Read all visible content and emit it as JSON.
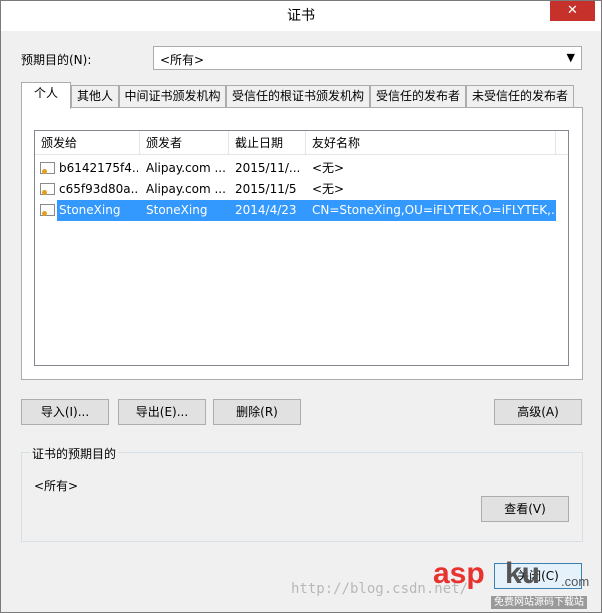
{
  "window": {
    "title": "证书",
    "close": "✕"
  },
  "purpose": {
    "label": "预期目的(N):",
    "value": "<所有>"
  },
  "tabs": [
    {
      "label": "个人"
    },
    {
      "label": "其他人"
    },
    {
      "label": "中间证书颁发机构"
    },
    {
      "label": "受信任的根证书颁发机构"
    },
    {
      "label": "受信任的发布者"
    },
    {
      "label": "未受信任的发布者"
    }
  ],
  "list": {
    "columns": [
      "颁发给",
      "颁发者",
      "截止日期",
      "友好名称"
    ],
    "rows": [
      {
        "issued_to": "b6142175f4...",
        "issuer": "Alipay.com ...",
        "expiry": "2015/11/...",
        "friendly": "<无>"
      },
      {
        "issued_to": "c65f93d80a...",
        "issuer": "Alipay.com ...",
        "expiry": "2015/11/5",
        "friendly": "<无>"
      },
      {
        "issued_to": "StoneXing",
        "issuer": "StoneXing",
        "expiry": "2014/4/23",
        "friendly": "CN=StoneXing,OU=iFLYTEK,O=iFLYTEK,..."
      }
    ],
    "selected_row": 2
  },
  "buttons": {
    "import": "导入(I)...",
    "export": "导出(E)...",
    "remove": "删除(R)",
    "advanced": "高级(A)",
    "view": "查看(V)",
    "close": "关闭(C)"
  },
  "purpose_group": {
    "title": "证书的预期目的",
    "value": "<所有>"
  },
  "watermark": {
    "text": "http://blog.csdn.net/",
    "logo_asp": "asp",
    "logo_ku": "ku",
    "logo_com": ".com",
    "logo_sub": "免费网站源码下载站"
  }
}
